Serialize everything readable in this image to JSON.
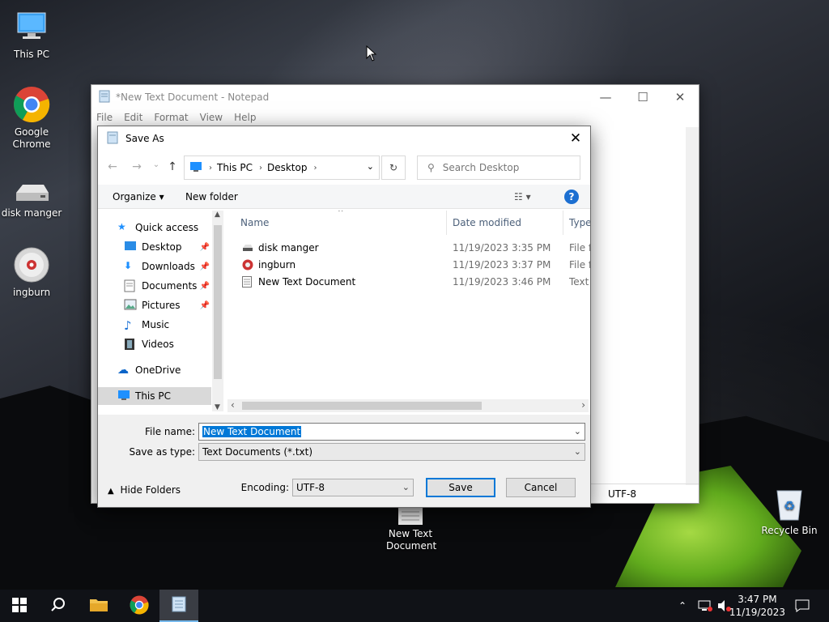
{
  "desktop": {
    "icons": [
      {
        "label": "This PC"
      },
      {
        "label": "Google Chrome"
      },
      {
        "label": "disk manger"
      },
      {
        "label": "ingburn"
      },
      {
        "label": "New Text Document"
      },
      {
        "label": "Recycle Bin"
      }
    ]
  },
  "notepad": {
    "title": "*New Text Document - Notepad",
    "menu": [
      "File",
      "Edit",
      "Format",
      "View",
      "Help"
    ],
    "encoding_status": "UTF-8"
  },
  "dialog": {
    "title": "Save As",
    "breadcrumb": [
      "This PC",
      "Desktop"
    ],
    "search_placeholder": "Search Desktop",
    "organize_label": "Organize",
    "new_folder_label": "New folder",
    "help_label": "?",
    "nav": {
      "quick_access": "Quick access",
      "items": [
        "Desktop",
        "Downloads",
        "Documents",
        "Pictures",
        "Music",
        "Videos"
      ],
      "onedrive": "OneDrive",
      "this_pc": "This PC"
    },
    "columns": {
      "name": "Name",
      "date": "Date modified",
      "type": "Type"
    },
    "files": [
      {
        "name": "disk manger",
        "date": "11/19/2023 3:35 PM",
        "type": "File fo"
      },
      {
        "name": "ingburn",
        "date": "11/19/2023 3:37 PM",
        "type": "File fo"
      },
      {
        "name": "New Text Document",
        "date": "11/19/2023 3:46 PM",
        "type": "Text D"
      }
    ],
    "file_name_label": "File name:",
    "file_name_value": "New Text Document",
    "save_as_type_label": "Save as type:",
    "save_as_type_value": "Text Documents (*.txt)",
    "hide_folders_label": "Hide Folders",
    "encoding_label": "Encoding:",
    "encoding_value": "UTF-8",
    "save_label": "Save",
    "cancel_label": "Cancel"
  },
  "taskbar": {
    "time": "3:47 PM",
    "date": "11/19/2023"
  },
  "colors": {
    "accent": "#0078d7",
    "taskbar": "#101217"
  }
}
